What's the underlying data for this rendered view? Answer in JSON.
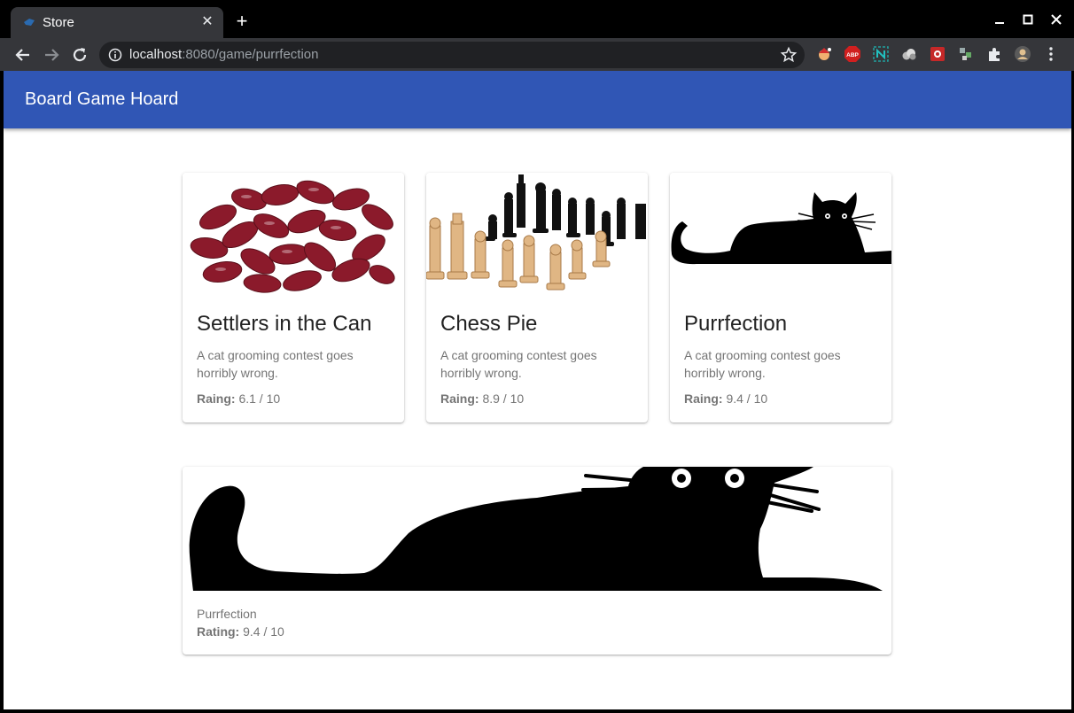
{
  "browser": {
    "tab_title": "Store",
    "url_host": "localhost",
    "url_path": ":8080/game/purrfection",
    "new_tab_label": "+",
    "close_tab_label": "✕"
  },
  "app": {
    "title": "Board Game Hoard"
  },
  "games": [
    {
      "title": "Settlers in the Can",
      "description": "A cat grooming contest goes horribly wrong.",
      "rating_label": "Raing:",
      "rating_value": "6.1 / 10",
      "image": "red-beans"
    },
    {
      "title": "Chess Pie",
      "description": "A cat grooming contest goes horribly wrong.",
      "rating_label": "Raing:",
      "rating_value": "8.9 / 10",
      "image": "chess-pieces"
    },
    {
      "title": "Purrfection",
      "description": "A cat grooming contest goes horribly wrong.",
      "rating_label": "Raing:",
      "rating_value": "9.4 / 10",
      "image": "black-cat"
    }
  ],
  "detail": {
    "name": "Purrfection",
    "rating_label": "Rating:",
    "rating_value": "9.4 / 10",
    "image": "black-cat"
  },
  "colors": {
    "appbar": "#3056b5",
    "chrome_toolbar": "#35363a",
    "omnibox": "#202124"
  }
}
